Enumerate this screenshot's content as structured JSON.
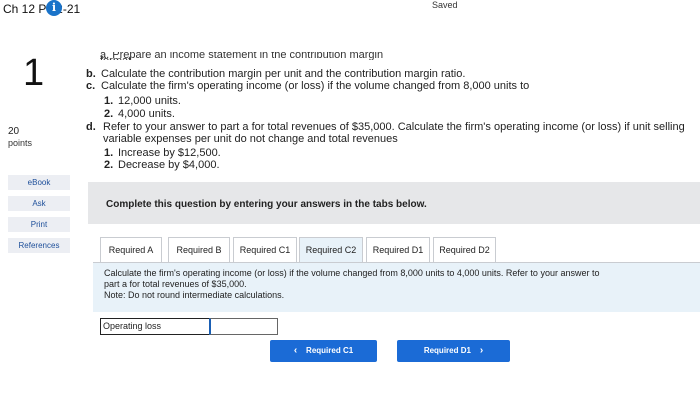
{
  "header": {
    "title": "Ch 12 P 12-21",
    "info_icon_glyph": "i",
    "saved": "Saved"
  },
  "sidebar": {
    "question_number": "1",
    "points_value": "20",
    "points_label": "points",
    "buttons": [
      "eBook",
      "Ask",
      "Print",
      "References"
    ]
  },
  "problem": {
    "cut_text": "a. Prepare an income statement in the contribution margin format.",
    "b": {
      "label": "b.",
      "text": "Calculate the contribution margin per unit and the contribution margin ratio."
    },
    "c": {
      "label": "c.",
      "text": "Calculate the firm's operating income (or loss) if the volume changed from 8,000 units to"
    },
    "c1": {
      "label": "1.",
      "text": "12,000 units."
    },
    "c2": {
      "label": "2.",
      "text": "4,000 units."
    },
    "d": {
      "label": "d.",
      "text": "Refer to your answer to part a for total revenues of $35,000. Calculate the firm's operating income (or loss) if unit selling",
      "text2": "variable expenses per unit do not change and total revenues"
    },
    "d1": {
      "label": "1.",
      "text": "Increase by $12,500."
    },
    "d2": {
      "label": "2.",
      "text": "Decrease by $4,000."
    }
  },
  "banner": {
    "text": "Complete this question by entering your answers in the tabs below."
  },
  "tabs": [
    {
      "label": "Required A",
      "active": false
    },
    {
      "label": "Required B",
      "active": false
    },
    {
      "label": "Required C1",
      "active": false
    },
    {
      "label": "Required C2",
      "active": true
    },
    {
      "label": "Required D1",
      "active": false
    },
    {
      "label": "Required D2",
      "active": false
    }
  ],
  "panel": {
    "line1": "Calculate the firm's operating income (or loss) if the volume changed from 8,000 units to 4,000 units. Refer to your answer to",
    "line2": "part a for total revenues of $35,000.",
    "note": "Note: Do not round intermediate calculations."
  },
  "answer": {
    "label": "Operating loss",
    "value": ""
  },
  "nav": {
    "prev_label": "Required C1",
    "prev_icon": "‹",
    "next_label": "Required D1",
    "next_icon": "›"
  },
  "colors": {
    "accent": "#1b6bd6",
    "panel_bg": "#e8f2f9",
    "banner_bg": "#e6e7e9"
  }
}
